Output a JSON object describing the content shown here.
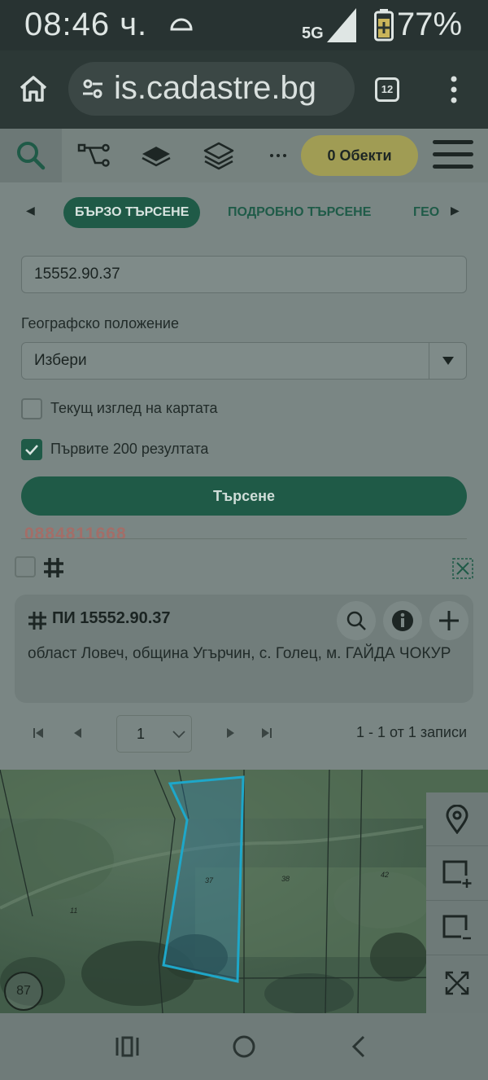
{
  "status_bar": {
    "time": "08:46 ч.",
    "network": "5G",
    "battery": "77%"
  },
  "browser": {
    "url": "is.cadastre.bg",
    "tab_count": "12"
  },
  "toolbar": {
    "objects_label": "0 Обекти"
  },
  "search_tabs": {
    "quick": "БЪРЗО ТЪРСЕНЕ",
    "detailed": "ПОДРОБНО ТЪРСЕНЕ",
    "geo": "ГЕО"
  },
  "form": {
    "query_value": "15552.90.37",
    "geo_label": "Географско положение",
    "geo_selected": "Избери",
    "current_view_label": "Текущ изглед на картата",
    "current_view_checked": false,
    "first_200_label": "Първите 200 резултата",
    "first_200_checked": true,
    "search_button": "Търсене"
  },
  "watermark_phone": "0884811668",
  "result": {
    "title": "ПИ 15552.90.37",
    "description": "област Ловеч, община Угърчин, с. Голец, м. ГАЙДА ЧОКУР"
  },
  "pager": {
    "page": "1",
    "info": "1 - 1 от 1 записи"
  },
  "map": {
    "parcel_labels": [
      "37",
      "38",
      "42",
      "11"
    ],
    "zoom_level": "87",
    "highlight_color": "#1ea7c9"
  }
}
